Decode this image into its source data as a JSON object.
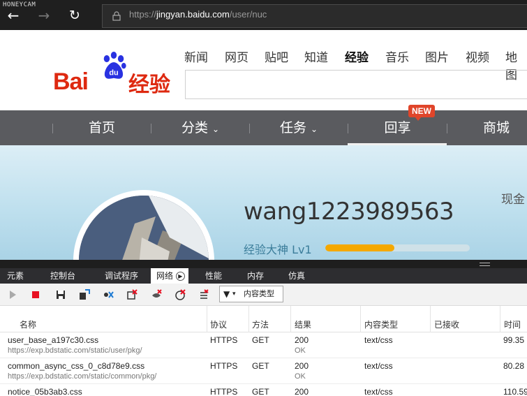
{
  "browser": {
    "watermark": "HONEYCAM",
    "back_icon": "arrow-left-icon",
    "forward_icon": "arrow-right-icon",
    "refresh_icon": "refresh-icon",
    "url_prefix": "https://",
    "url_domain": "jingyan.baidu.com",
    "url_path": "/user/nuc"
  },
  "header": {
    "logo_bai": "Bai",
    "logo_du": "du",
    "logo_jingyan": "经验",
    "top_links": [
      "新闻",
      "网页",
      "贴吧",
      "知道",
      "经验",
      "音乐",
      "图片",
      "视频",
      "地图"
    ],
    "active_link": "经验"
  },
  "nav": {
    "items": [
      "首页",
      "分类",
      "任务",
      "回享",
      "商城"
    ],
    "dropdown_items": [
      "分类",
      "任务"
    ],
    "active": "回享",
    "badge": "NEW"
  },
  "profile": {
    "username": "wang1223989563",
    "level": "经验大神 Lv1",
    "progress_fraction": 0.48,
    "cash_label": "现金"
  },
  "devtools": {
    "tabs": [
      "元素",
      "控制台",
      "调试程序",
      "网络",
      "性能",
      "内存",
      "仿真"
    ],
    "active_tab": "网络",
    "filter_label": "内容类型",
    "columns": [
      "名称",
      "协议",
      "方法",
      "结果",
      "内容类型",
      "已接收",
      "时间"
    ],
    "rows": [
      {
        "name": "user_base_a197c30.css",
        "path": "https://exp.bdstatic.com/static/user/pkg/",
        "protocol": "HTTPS",
        "method": "GET",
        "status": "200",
        "status_text": "OK",
        "type": "text/css",
        "received": "",
        "time": "99.35"
      },
      {
        "name": "common_async_css_0_c8d78e9.css",
        "path": "https://exp.bdstatic.com/static/common/pkg/",
        "protocol": "HTTPS",
        "method": "GET",
        "status": "200",
        "status_text": "OK",
        "type": "text/css",
        "received": "",
        "time": "80.28"
      },
      {
        "name": "notice_05b3ab3.css",
        "path": "",
        "protocol": "HTTPS",
        "method": "GET",
        "status": "200",
        "status_text": "",
        "type": "text/css",
        "received": "",
        "time": "110.59"
      }
    ]
  },
  "colors": {
    "brand_red": "#de2910",
    "brand_blue": "#2932e1",
    "nav_bg": "#5a5b5f",
    "progress": "#f5a800",
    "badge": "#e0452a"
  }
}
